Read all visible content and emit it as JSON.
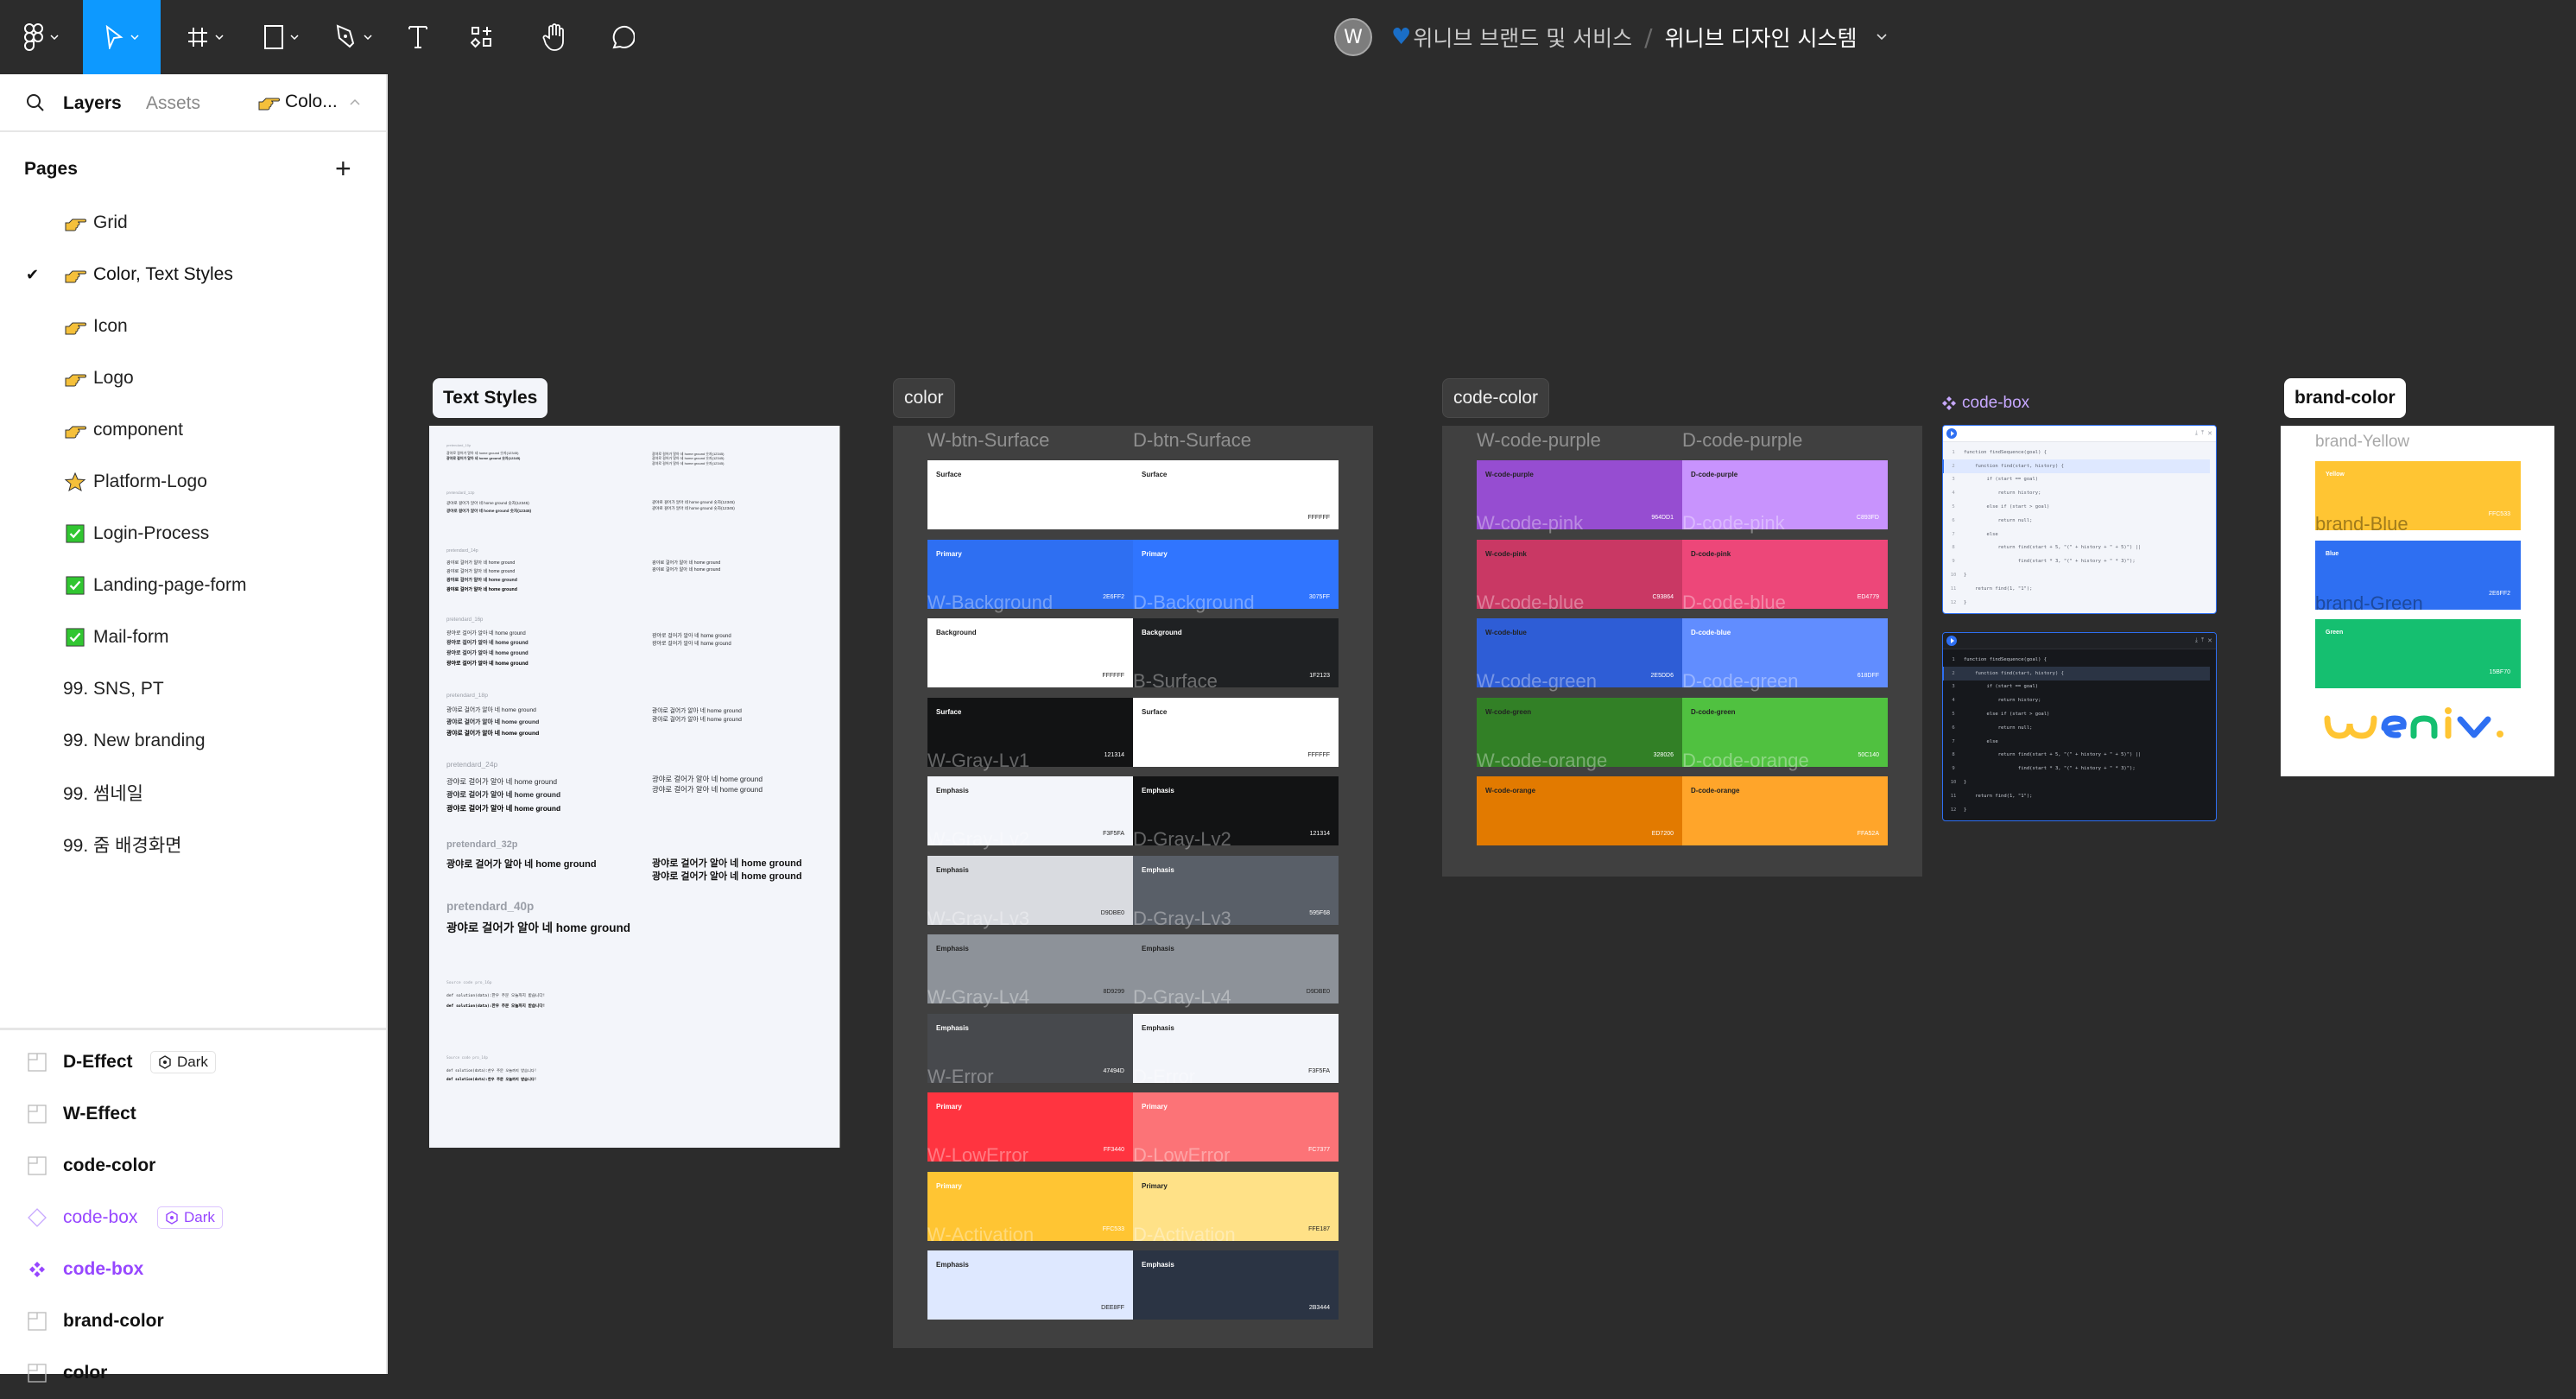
{
  "toolbar": {
    "tools": [
      "main-menu",
      "move",
      "frame",
      "shape",
      "pen",
      "text",
      "resources",
      "hand",
      "comment"
    ],
    "active_tool": "move"
  },
  "header": {
    "avatar_initial": "W",
    "project_emoji": "♥",
    "project_name": "위니브 브랜드 및 서비스",
    "separator": "/",
    "file_name": "위니브 디자인 시스템"
  },
  "left_panel": {
    "tab_layers": "Layers",
    "tab_assets": "Assets",
    "current_page_short": "Colo...",
    "pages_title": "Pages",
    "pages": [
      {
        "label": "Grid",
        "icon": "pointing-hand",
        "selected": false
      },
      {
        "label": "Color, Text Styles",
        "icon": "pointing-hand",
        "selected": true
      },
      {
        "label": "Icon",
        "icon": "pointing-hand",
        "selected": false
      },
      {
        "label": "Logo",
        "icon": "pointing-hand",
        "selected": false
      },
      {
        "label": "component",
        "icon": "pointing-hand",
        "selected": false
      },
      {
        "label": "Platform-Logo",
        "icon": "star",
        "selected": false
      },
      {
        "label": "Login-Process",
        "icon": "check-box",
        "selected": false
      },
      {
        "label": "Landing-page-form",
        "icon": "check-box",
        "selected": false
      },
      {
        "label": "Mail-form",
        "icon": "check-box",
        "selected": false
      },
      {
        "label": "99. SNS, PT",
        "icon": "",
        "selected": false
      },
      {
        "label": "99. New branding",
        "icon": "",
        "selected": false
      },
      {
        "label": "99. 썸네일",
        "icon": "",
        "selected": false
      },
      {
        "label": "99. 줌 배경화면",
        "icon": "",
        "selected": false
      }
    ],
    "layers": [
      {
        "label": "D-Effect",
        "icon": "frame",
        "badge": "Dark"
      },
      {
        "label": "W-Effect",
        "icon": "frame",
        "badge": ""
      },
      {
        "label": "code-color",
        "icon": "frame",
        "badge": ""
      },
      {
        "label": "code-box",
        "icon": "instance",
        "badge": "Dark"
      },
      {
        "label": "code-box",
        "icon": "component",
        "badge": ""
      },
      {
        "label": "brand-color",
        "icon": "frame",
        "badge": ""
      },
      {
        "label": "color",
        "icon": "frame",
        "badge": ""
      }
    ]
  },
  "canvas": {
    "frames": {
      "text_styles": "Text Styles",
      "color": "color",
      "code_color": "code-color",
      "code_box": "code-box",
      "brand_color": "brand-color"
    },
    "text_styles": {
      "sample": "광야로 걸어가 알아 네 home ground",
      "sample_num": "광야로 걸어가 알아 네 home ground 숫자(12345)",
      "code_sample": "def solution(data):한우 주문 오늘까지 받습니다!",
      "groups": [
        {
          "caption": "pretendard_10p"
        },
        {
          "caption": "pretendard_12p"
        },
        {
          "caption": "pretendard_14p"
        },
        {
          "caption": "pretendard_16p"
        },
        {
          "caption": "pretendard_18p"
        },
        {
          "caption": "pretendard_24p"
        },
        {
          "caption": "pretendard_32p"
        },
        {
          "caption": "pretendard_40p"
        },
        {
          "caption": "Source code pro_16p"
        },
        {
          "caption": "Source code pro_14p"
        }
      ]
    },
    "color": {
      "head_left": "W-btn-Surface",
      "head_right": "D-btn-Surface",
      "rows": [
        {
          "l_name": "Surface",
          "l_hex": "",
          "l_color": "#ffffff",
          "r_name": "Surface",
          "r_hex": "FFFFFF",
          "r_color": "#ffffff",
          "l_over": "",
          "r_over": "",
          "l_dark_text": true,
          "r_dark_text": true,
          "merged": true
        },
        {
          "l_name": "Primary",
          "l_hex": "2E6FF2",
          "l_color": "#2e6ff2",
          "r_name": "Primary",
          "r_hex": "3075FF",
          "r_color": "#3075ff",
          "l_over": "W-Background",
          "r_over": "D-Background",
          "l_dark_text": false,
          "r_dark_text": false
        },
        {
          "l_name": "Background",
          "l_hex": "FFFFFF",
          "l_color": "#ffffff",
          "r_name": "Background",
          "r_hex": "1F2123",
          "r_color": "#1f2123",
          "l_over": "",
          "r_over": "B-Surface",
          "l_dark_text": true,
          "r_dark_text": false
        },
        {
          "l_name": "Surface",
          "l_hex": "121314",
          "l_color": "#121314",
          "r_name": "Surface",
          "r_hex": "FFFFFF",
          "r_color": "#ffffff",
          "l_over": "W-Gray-Lv1",
          "r_over": "",
          "l_dark_text": false,
          "r_dark_text": true
        },
        {
          "l_name": "Emphasis",
          "l_hex": "F3F5FA",
          "l_color": "#f3f5fa",
          "r_name": "Emphasis",
          "r_hex": "121314",
          "r_color": "#121314",
          "l_over": "W-Gray-Lv2",
          "r_over": "D-Gray-Lv2",
          "l_dark_text": true,
          "r_dark_text": false
        },
        {
          "l_name": "Emphasis",
          "l_hex": "D9DBE0",
          "l_color": "#d9dbe0",
          "r_name": "Emphasis",
          "r_hex": "595F68",
          "r_color": "#595f68",
          "l_over": "W-Gray-Lv3",
          "r_over": "D-Gray-Lv3",
          "l_dark_text": true,
          "r_dark_text": false
        },
        {
          "l_name": "Emphasis",
          "l_hex": "8D9299",
          "l_color": "#8d9299",
          "r_name": "Emphasis",
          "r_hex": "D9DBE0",
          "r_color": "#8d9299",
          "l_over": "W-Gray-Lv4",
          "r_over": "D-Gray-Lv4",
          "l_dark_text": true,
          "r_dark_text": true
        },
        {
          "l_name": "Emphasis",
          "l_hex": "47494D",
          "l_color": "#47494d",
          "r_name": "Emphasis",
          "r_hex": "F3F5FA",
          "r_color": "#f3f5fa",
          "l_over": "W-Error",
          "r_over": "D-Error",
          "l_dark_text": false,
          "r_dark_text": true
        },
        {
          "l_name": "Primary",
          "l_hex": "FF3440",
          "l_color": "#ff3440",
          "r_name": "Primary",
          "r_hex": "FC7377",
          "r_color": "#fc7377",
          "l_over": "W-LowError",
          "r_over": "D-LowError",
          "l_dark_text": false,
          "r_dark_text": false
        },
        {
          "l_name": "Primary",
          "l_hex": "FFC533",
          "l_color": "#ffc533",
          "r_name": "Primary",
          "r_hex": "FFE187",
          "r_color": "#ffe187",
          "l_over": "W-Activation",
          "r_over": "D-Activation",
          "l_dark_text": false,
          "r_dark_text": true
        },
        {
          "l_name": "Emphasis",
          "l_hex": "DEE8FF",
          "l_color": "#dee8ff",
          "r_name": "Emphasis",
          "r_hex": "2B3444",
          "r_color": "#2b3444",
          "l_over": "",
          "r_over": "",
          "l_dark_text": true,
          "r_dark_text": false
        }
      ]
    },
    "code_color": {
      "head_left": "W-code-purple",
      "head_right": "D-code-purple",
      "rows": [
        {
          "l_name": "W-code-purple",
          "l_hex": "964DD1",
          "l_color": "#964dd1",
          "r_name": "D-code-purple",
          "r_hex": "C893FD",
          "r_color": "#c893fd",
          "l_over": "W-code-pink",
          "r_over": "D-code-pink"
        },
        {
          "l_name": "W-code-pink",
          "l_hex": "C93864",
          "l_color": "#c93864",
          "r_name": "D-code-pink",
          "r_hex": "ED4779",
          "r_color": "#ed4779",
          "l_over": "W-code-blue",
          "r_over": "D-code-blue"
        },
        {
          "l_name": "W-code-blue",
          "l_hex": "2E5DD6",
          "l_color": "#2e5dd6",
          "r_name": "D-code-blue",
          "r_hex": "618DFF",
          "r_color": "#618dff",
          "l_over": "W-code-green",
          "r_over": "D-code-green"
        },
        {
          "l_name": "W-code-green",
          "l_hex": "328026",
          "l_color": "#328026",
          "r_name": "D-code-green",
          "r_hex": "50C140",
          "r_color": "#50c140",
          "l_over": "W-code-orange",
          "r_over": "D-code-orange"
        },
        {
          "l_name": "W-code-orange",
          "l_hex": "ED7200",
          "l_color": "#e27a00",
          "r_name": "D-code-orange",
          "r_hex": "FFA52A",
          "r_color": "#ffa52a",
          "l_over": "",
          "r_over": ""
        }
      ]
    },
    "code_box": {
      "actions": [
        "download-icon",
        "upload-icon",
        "close-icon"
      ],
      "lines": [
        "function findSequence(goal) {",
        "    function find(start, history) {",
        "        if (start == goal)",
        "            return history;",
        "        else if (start > goal)",
        "            return null;",
        "        else",
        "            return find(start + 5, \"(\" + history + \" + 5)\") ||",
        "                   find(start * 3, \"(\" + history + \" * 3)\");",
        "}",
        "    return find(1, \"1\");",
        "}"
      ],
      "highlight_line": 2
    },
    "brand_color": {
      "head": "brand-Yellow",
      "swatches": [
        {
          "name": "Yellow",
          "hex": "FFC533",
          "color": "#ffc533",
          "over": "brand-Blue",
          "over_color": "#a07b1c"
        },
        {
          "name": "Blue",
          "hex": "2E6FF2",
          "color": "#2e6ff2",
          "over": "brand-Green",
          "over_color": "#1d4a9e"
        },
        {
          "name": "Green",
          "hex": "15BF70",
          "color": "#15bf70",
          "over": "",
          "over_color": ""
        }
      ],
      "logo_text": "weniv."
    }
  }
}
